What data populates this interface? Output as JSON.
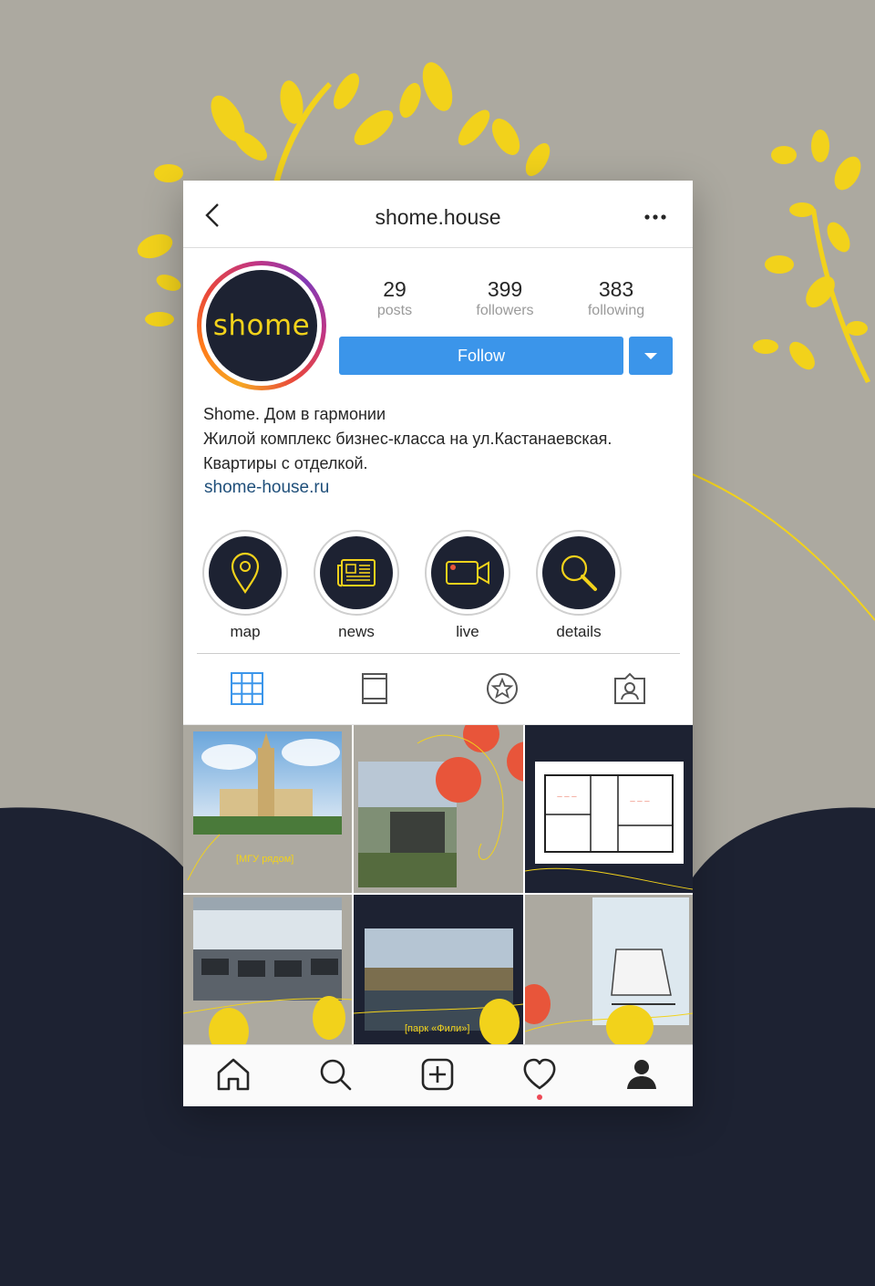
{
  "colors": {
    "background_gray": "#aca9a0",
    "dark_navy": "#1d2232",
    "brand_yellow": "#f2d21b",
    "follow_blue": "#3b95ea",
    "link_blue": "#1f4f7a",
    "orange": "#e8553a"
  },
  "header": {
    "username": "shome.house",
    "back_icon": "chevron-left-icon",
    "more_icon": "more-horizontal-icon"
  },
  "profile": {
    "avatar_text": "shome",
    "stats": {
      "posts": {
        "value": "29",
        "label": "posts"
      },
      "followers": {
        "value": "399",
        "label": "followers"
      },
      "following": {
        "value": "383",
        "label": "following"
      }
    },
    "follow_label": "Follow",
    "bio_lines": [
      "Shome. Дом в гармонии",
      "Жилой комплекс бизнес-класса на ул.Кастанаевская.",
      "Квартиры с отделкой."
    ],
    "link": "shome-house.ru"
  },
  "highlights": [
    {
      "label": "map",
      "icon": "map-pin-icon"
    },
    {
      "label": "news",
      "icon": "newspaper-icon"
    },
    {
      "label": "live",
      "icon": "video-camera-icon"
    },
    {
      "label": "details",
      "icon": "magnifier-icon"
    }
  ],
  "tabs": [
    {
      "icon": "grid-icon",
      "active": true
    },
    {
      "icon": "feed-icon",
      "active": false
    },
    {
      "icon": "star-icon",
      "active": false
    },
    {
      "icon": "tagged-icon",
      "active": false
    }
  ],
  "posts": [
    {
      "caption": "[МГУ рядом]"
    },
    {
      "caption": ""
    },
    {
      "caption": ""
    },
    {
      "caption": ""
    },
    {
      "caption": "[парк «Фили»]"
    },
    {
      "caption": ""
    }
  ],
  "bottom_nav": [
    "home-icon",
    "search-icon",
    "add-post-icon",
    "heart-icon",
    "profile-icon"
  ]
}
